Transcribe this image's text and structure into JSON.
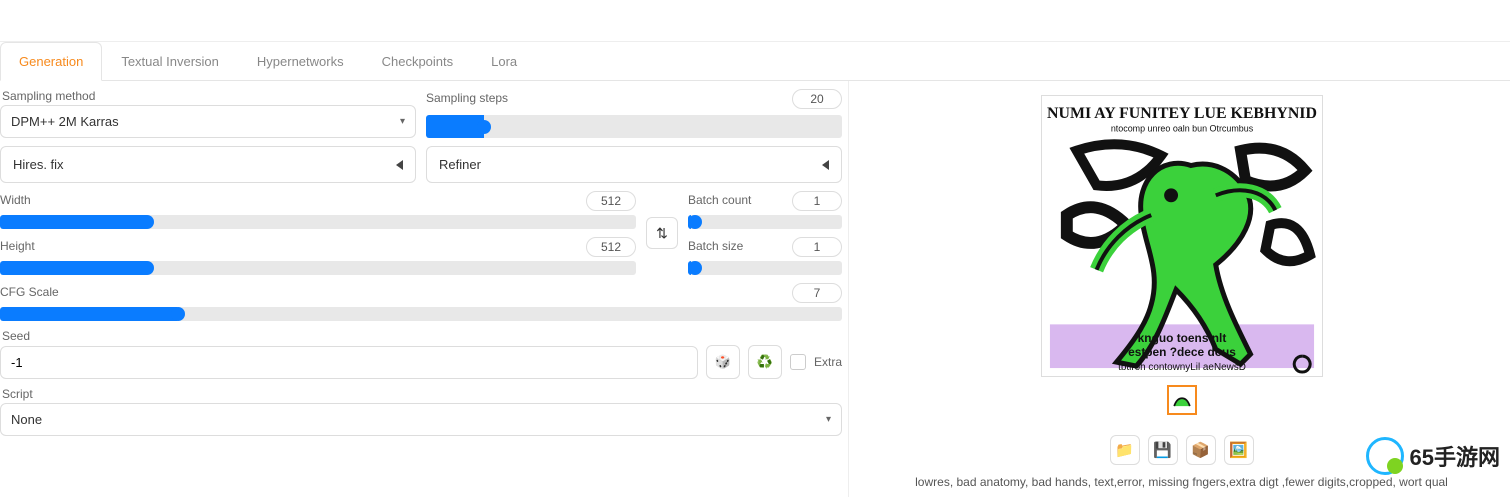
{
  "tabs": {
    "generation": "Generation",
    "textual_inversion": "Textual Inversion",
    "hypernetworks": "Hypernetworks",
    "checkpoints": "Checkpoints",
    "lora": "Lora"
  },
  "sampling_method": {
    "label": "Sampling method",
    "value": "DPM++ 2M Karras"
  },
  "sampling_steps": {
    "label": "Sampling steps",
    "value": "20"
  },
  "hires_fix": {
    "label": "Hires. fix"
  },
  "refiner": {
    "label": "Refiner"
  },
  "width": {
    "label": "Width",
    "value": "512"
  },
  "height": {
    "label": "Height",
    "value": "512"
  },
  "batch_count": {
    "label": "Batch count",
    "value": "1"
  },
  "batch_size": {
    "label": "Batch size",
    "value": "1"
  },
  "cfg": {
    "label": "CFG Scale",
    "value": "7"
  },
  "seed": {
    "label": "Seed",
    "value": "-1"
  },
  "extra": {
    "label": "Extra"
  },
  "script": {
    "label": "Script",
    "value": "None"
  },
  "output": {
    "caption": "lowres, bad anatomy, bad hands, text,error, missing fngers,extra digt ,fewer digits,cropped, wort qual",
    "buttons": {
      "folder": "📁",
      "save": "💾",
      "zip": "📦",
      "send_img2img": "🖼️"
    }
  },
  "icons": {
    "dice": "🎲",
    "recycle": "♻️",
    "swap": "⇅",
    "caret_down": "▾"
  },
  "watermark": {
    "text": "65手游网"
  }
}
